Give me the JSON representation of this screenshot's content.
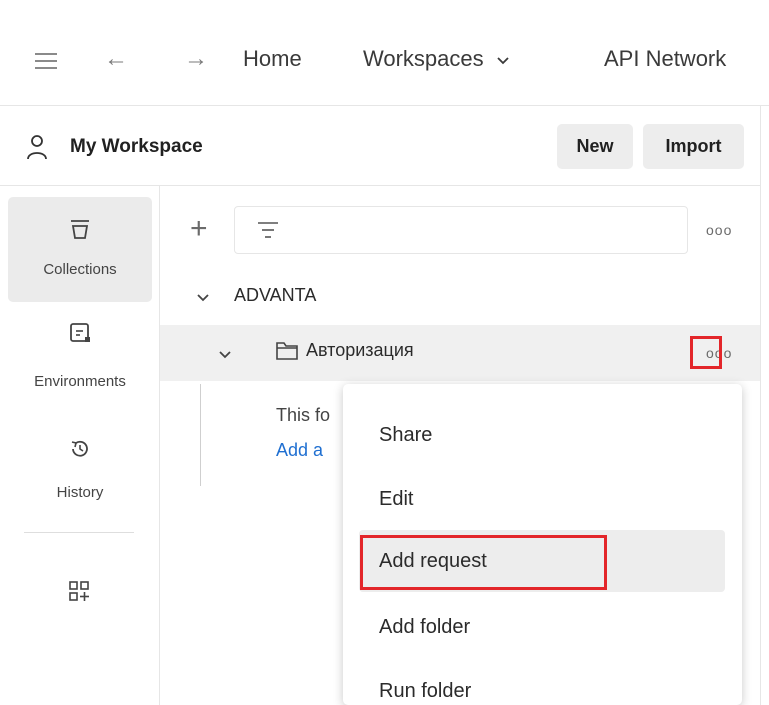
{
  "topbar": {
    "home": "Home",
    "workspaces": "Workspaces",
    "api_network": "API Network"
  },
  "workspace": {
    "title": "My Workspace",
    "new_label": "New",
    "import_label": "Import"
  },
  "rail": {
    "items": [
      {
        "label": "Collections"
      },
      {
        "label": "Environments"
      },
      {
        "label": "History"
      }
    ]
  },
  "tree": {
    "collection": "ADVANTA",
    "folder": "Авторизация",
    "empty_line1": "This fo",
    "empty_line2": "Add a"
  },
  "menu": {
    "items": [
      {
        "label": "Share"
      },
      {
        "label": "Edit"
      },
      {
        "label": "Add request"
      },
      {
        "label": "Add folder"
      },
      {
        "label": "Run folder"
      }
    ],
    "highlighted": "Add request"
  },
  "colors": {
    "highlight_box": "#e3262a",
    "link": "#1f6fd1"
  }
}
